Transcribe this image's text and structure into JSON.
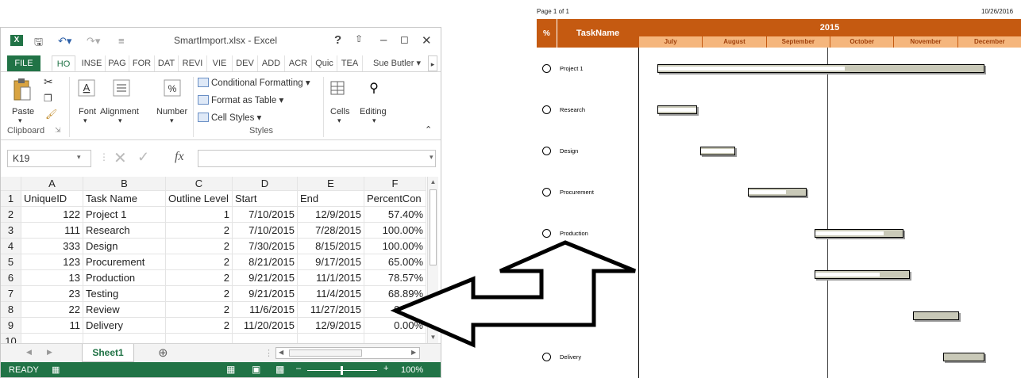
{
  "excel": {
    "title": "SmartImport.xlsx - Excel",
    "help": "?",
    "tabs": [
      "FILE",
      "HO",
      "INSE",
      "PAG",
      "FOR",
      "DAT",
      "REVI",
      "VIE",
      "DEV",
      "ADD",
      "ACR",
      "Quic",
      "TEA"
    ],
    "user": "Sue Butler",
    "ribbon": {
      "paste": "Paste",
      "clipboard": "Clipboard",
      "font": "Font",
      "alignment": "Alignment",
      "number": "Number",
      "conditional": "Conditional Formatting",
      "format_table": "Format as Table",
      "cell_styles": "Cell Styles",
      "styles": "Styles",
      "cells": "Cells",
      "editing": "Editing"
    },
    "namebox": "K19",
    "fx": "fx",
    "columns": [
      "A",
      "B",
      "C",
      "D",
      "E",
      "F"
    ],
    "rownums": [
      "1",
      "2",
      "3",
      "4",
      "5",
      "6",
      "7",
      "8",
      "9",
      "10"
    ],
    "rows": [
      [
        "UniqueID",
        "Task Name",
        "Outline Level",
        "Start",
        "End",
        "PercentCon"
      ],
      [
        "122",
        "Project 1",
        "1",
        "7/10/2015",
        "12/9/2015",
        "57.40%"
      ],
      [
        "111",
        "Research",
        "2",
        "7/10/2015",
        "7/28/2015",
        "100.00%"
      ],
      [
        "333",
        "Design",
        "2",
        "7/30/2015",
        "8/15/2015",
        "100.00%"
      ],
      [
        "123",
        "Procurement",
        "2",
        "8/21/2015",
        "9/17/2015",
        "65.00%"
      ],
      [
        "13",
        "Production",
        "2",
        "9/21/2015",
        "11/1/2015",
        "78.57%"
      ],
      [
        "23",
        "Testing",
        "2",
        "9/21/2015",
        "11/4/2015",
        "68.89%"
      ],
      [
        "22",
        "Review",
        "2",
        "11/6/2015",
        "11/27/2015",
        "0.00%"
      ],
      [
        "11",
        "Delivery",
        "2",
        "11/20/2015",
        "12/9/2015",
        "0.00%"
      ],
      [
        "",
        "",
        "",
        "",
        "",
        ""
      ]
    ],
    "sheet": "Sheet1",
    "status": "READY",
    "zoom": "100%"
  },
  "report": {
    "page": "Page 1 of 1",
    "date": "10/26/2016",
    "pct_header": "%",
    "taskname_header": "TaskName",
    "year": "2015",
    "months": [
      "July",
      "August",
      "September",
      "October",
      "November",
      "December"
    ],
    "tasks": [
      {
        "name": "Project 1",
        "progress": 0.574
      },
      {
        "name": "Research",
        "progress": 1.0
      },
      {
        "name": "Design",
        "progress": 1.0
      },
      {
        "name": "Procurement",
        "progress": 0.65
      },
      {
        "name": "Production",
        "progress": 0.7857
      },
      {
        "name": "",
        "progress": 0.6889
      },
      {
        "name": "",
        "progress": 0.0
      },
      {
        "name": "Delivery",
        "progress": 0.0
      }
    ]
  }
}
